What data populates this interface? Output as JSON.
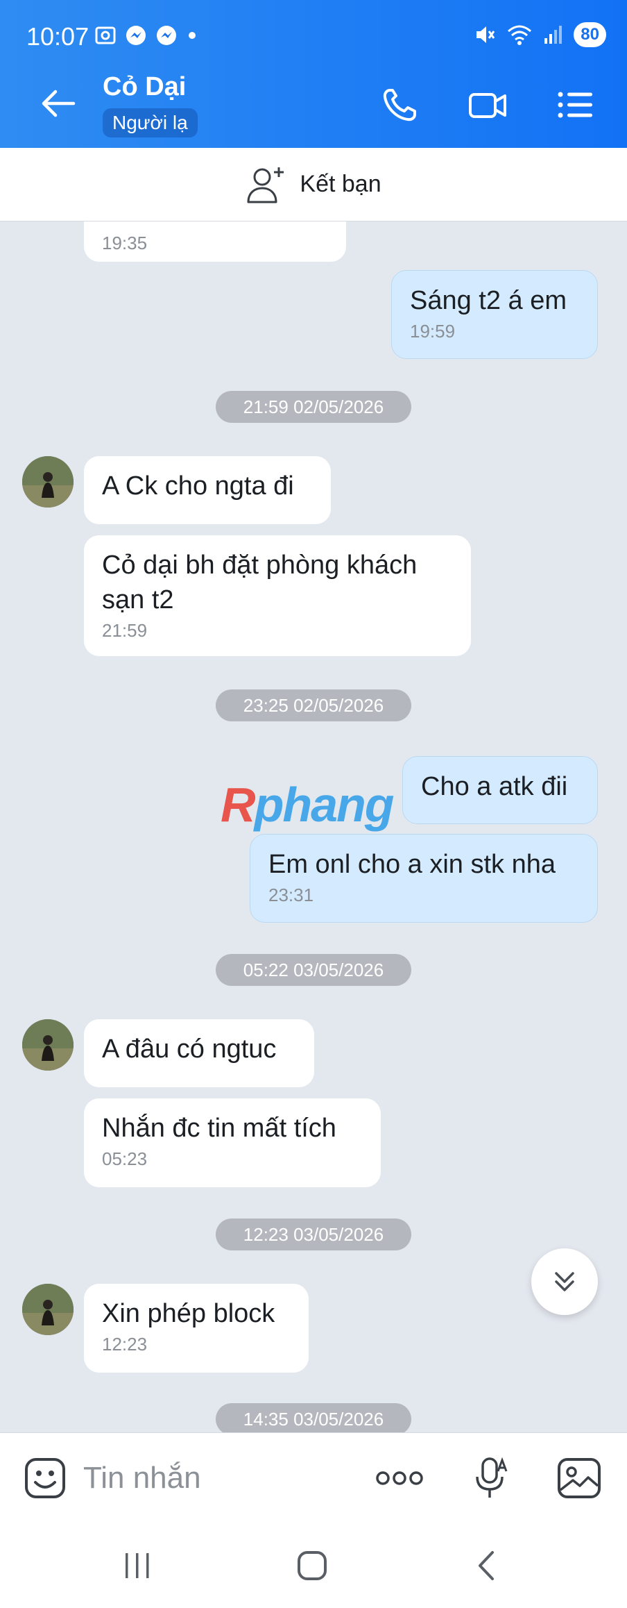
{
  "status_bar": {
    "time": "10:07",
    "battery": "80"
  },
  "header": {
    "contact_name": "Cỏ Dại",
    "badge": "Người lạ",
    "color": "#1a78f3"
  },
  "friend_bar": {
    "label": "Kết bạn"
  },
  "messages": [
    {
      "dir": "in",
      "text": "",
      "time": "19:35"
    },
    {
      "dir": "out",
      "text": "Sáng t2 á em",
      "time": "19:59"
    },
    {
      "separator": "21:59 02/05/2026"
    },
    {
      "dir": "in",
      "text": "A Ck cho ngta đi",
      "time": ""
    },
    {
      "dir": "in",
      "text": "Cỏ dại bh đặt phòng khách sạn t2",
      "time": "21:59"
    },
    {
      "separator": "23:25 02/05/2026"
    },
    {
      "dir": "out",
      "text": "Cho a atk đii",
      "time": ""
    },
    {
      "dir": "out",
      "text": "Em onl cho a xin stk nha",
      "time": "23:31"
    },
    {
      "separator": "05:22 03/05/2026"
    },
    {
      "dir": "in",
      "text": "A đâu có ngtuc",
      "time": ""
    },
    {
      "dir": "in",
      "text": "Nhắn đc tin mất tích",
      "time": "05:23"
    },
    {
      "separator": "12:23 03/05/2026"
    },
    {
      "dir": "in",
      "text": "Xin phép block",
      "time": "12:23"
    },
    {
      "separator": "14:35 03/05/2026"
    }
  ],
  "watermark": {
    "first": "R",
    "rest": "phang"
  },
  "composer": {
    "placeholder": "Tin nhắn"
  },
  "icons": {
    "back": "arrow-left-icon",
    "call": "phone-icon",
    "video": "video-camera-icon",
    "menu": "list-menu-icon",
    "add_friend": "add-person-icon",
    "emoji": "emoji-icon",
    "more": "more-dots-icon",
    "voice": "microphone-icon",
    "image": "image-icon",
    "scroll_down": "double-chevron-down-icon"
  },
  "colors": {
    "outgoing_bubble": "#d4ebff",
    "incoming_bubble": "#ffffff",
    "chat_bg": "#e3e7ee",
    "accent": "#1a78f3"
  }
}
